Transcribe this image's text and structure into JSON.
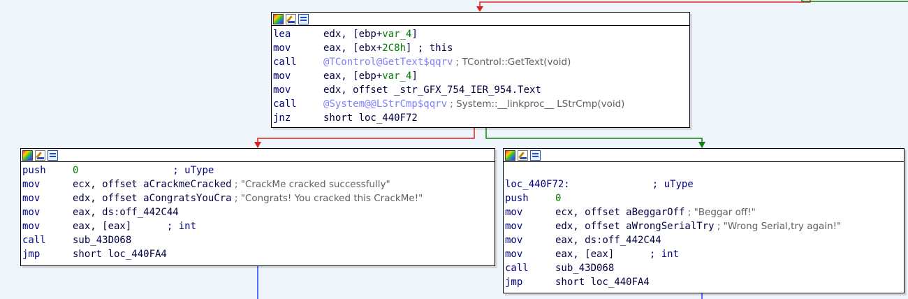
{
  "colors": {
    "background": "#eef5fb",
    "edge_false": "#e02020",
    "edge_true": "#108010",
    "edge_uncond": "#2040ff"
  },
  "header_icons": [
    "color-palette-icon",
    "rename-pencil-icon",
    "graph-view-icon"
  ],
  "blocks": {
    "top": {
      "lines": [
        {
          "mn": "lea",
          "a": "edx, [ebp+",
          "b": "var_4",
          "c": "]"
        },
        {
          "mn": "mov",
          "a": "eax, [ebx+",
          "b": "2C8h",
          "c": "]",
          "cmt": " ; this"
        },
        {
          "mn": "call",
          "imp": "@TControl@GetText$qqrv",
          "cmt": " ; TControl::GetText(void)"
        },
        {
          "mn": "mov",
          "a": "eax, [ebp+",
          "b": "var_4",
          "c": "]"
        },
        {
          "mn": "mov",
          "a": "edx, offset _str_GFX_754_IER_954.Text"
        },
        {
          "mn": "call",
          "imp": "@System@@LStrCmp$qqrv",
          "cmt": " ; System::__linkproc__ LStrCmp(void)"
        },
        {
          "mn": "jnz",
          "a": "short loc_440F72"
        }
      ]
    },
    "left": {
      "lines": [
        {
          "mn": "push",
          "num": "0",
          "pad": "                ",
          "cmt2": "; uType"
        },
        {
          "mn": "mov",
          "a": "ecx, offset aCrackmeCracked",
          "cmt": " ; ",
          "str": "\"CrackMe cracked successfully\""
        },
        {
          "mn": "mov",
          "a": "edx, offset aCongratsYouCra",
          "cmt": " ; ",
          "str": "\"Congrats! You cracked this CrackMe!\""
        },
        {
          "mn": "mov",
          "a": "eax, ds:off_442C44"
        },
        {
          "mn": "mov",
          "a": "eax, [eax]",
          "pad": "      ",
          "cmt2": "; int"
        },
        {
          "mn": "call",
          "a": "sub_43D068"
        },
        {
          "mn": "jmp",
          "a": "short loc_440FA4"
        }
      ]
    },
    "right": {
      "label": "loc_440F72:",
      "label_cmt": "; uType",
      "lines": [
        {
          "mn": "push",
          "num": "0"
        },
        {
          "mn": "mov",
          "a": "ecx, offset aBeggarOff",
          "cmt": " ; ",
          "str": "\"Beggar off!\""
        },
        {
          "mn": "mov",
          "a": "edx, offset aWrongSerialTry",
          "cmt": " ; ",
          "str": "\"Wrong Serial,try again!\""
        },
        {
          "mn": "mov",
          "a": "eax, ds:off_442C44"
        },
        {
          "mn": "mov",
          "a": "eax, [eax]",
          "pad": "      ",
          "cmt2": "; int"
        },
        {
          "mn": "call",
          "a": "sub_43D068"
        },
        {
          "mn": "jmp",
          "a": "short loc_440FA4"
        }
      ]
    }
  }
}
